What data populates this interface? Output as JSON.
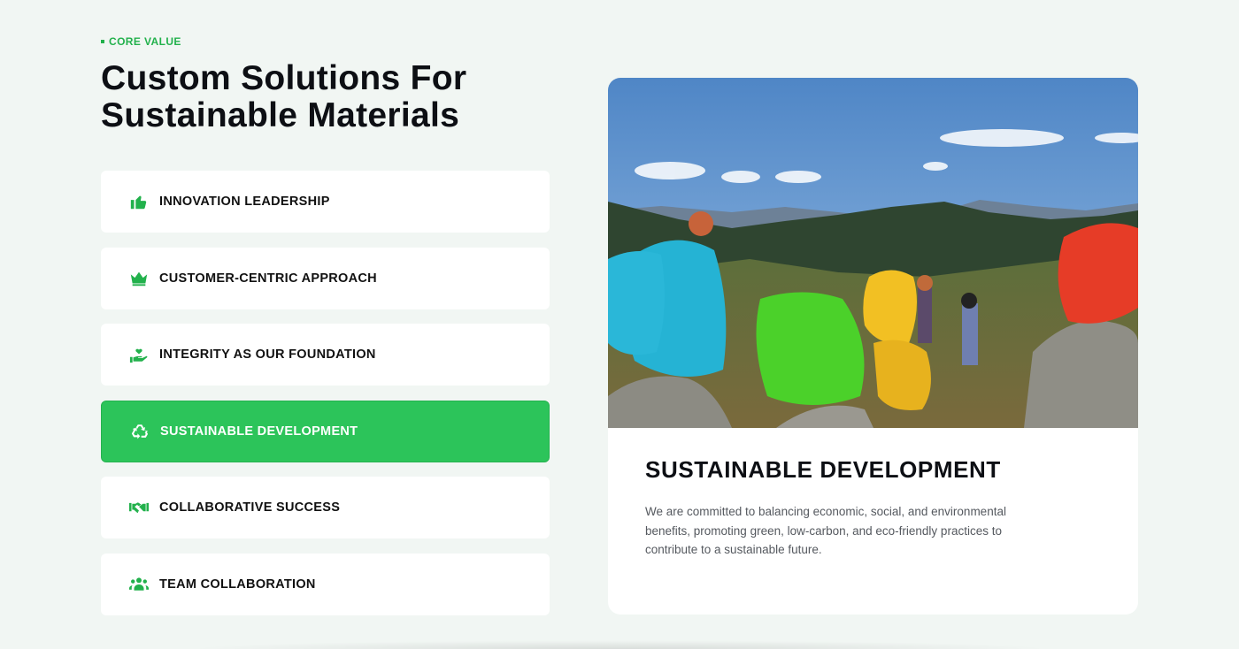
{
  "section": {
    "eyebrow": "CORE VALUE",
    "headline": "Custom Solutions For Sustainable Materials"
  },
  "values": [
    {
      "label": "INNOVATION LEADERSHIP",
      "icon": "thumbs-up-icon",
      "active": false
    },
    {
      "label": "CUSTOMER-CENTRIC APPROACH",
      "icon": "crown-icon",
      "active": false
    },
    {
      "label": "INTEGRITY AS OUR FOUNDATION",
      "icon": "hand-heart-icon",
      "active": false
    },
    {
      "label": "SUSTAINABLE DEVELOPMENT",
      "icon": "recycle-icon",
      "active": true
    },
    {
      "label": "COLLABORATIVE SUCCESS",
      "icon": "handshake-icon",
      "active": false
    },
    {
      "label": "TEAM COLLABORATION",
      "icon": "users-icon",
      "active": false
    }
  ],
  "detail": {
    "title": "SUSTAINABLE DEVELOPMENT",
    "body": "We are committed to balancing economic, social, and environmental benefits, promoting green, low-carbon, and eco-friendly practices to contribute to a sustainable future."
  },
  "colors": {
    "accent": "#2cc45a",
    "background": "#f1f6f3"
  }
}
